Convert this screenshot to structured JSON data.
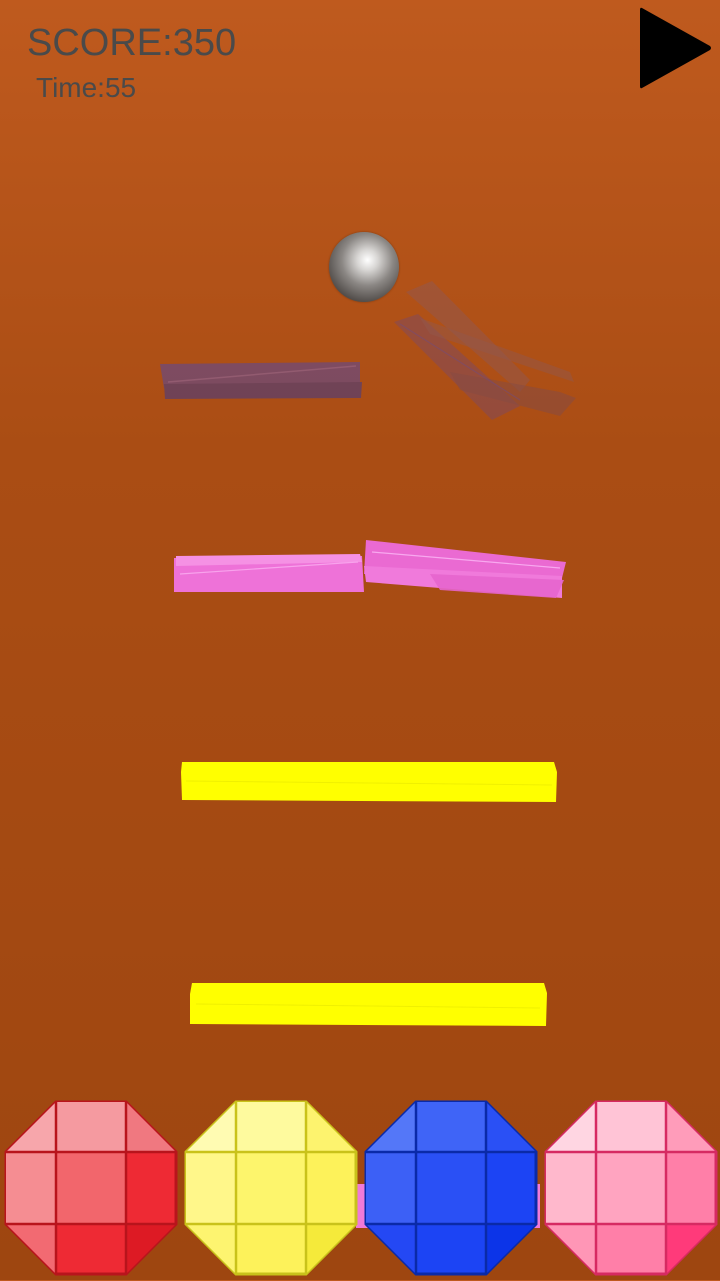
{
  "hud": {
    "score_label": "SCORE:350",
    "time_label": "Time:55"
  },
  "play_button": {
    "icon": "play-icon"
  },
  "ball": {
    "icon": "ball-icon"
  },
  "platforms": [
    {
      "color": "#6e4a78",
      "state": "shattering"
    },
    {
      "color": "#ee72d8",
      "state": "shattering"
    },
    {
      "color": "#ffff00",
      "state": "intact"
    },
    {
      "color": "#ffff00",
      "state": "intact"
    }
  ],
  "color_buttons": [
    {
      "color": "red",
      "hex": "#ee2a34"
    },
    {
      "color": "yellow",
      "hex": "#fdf25a"
    },
    {
      "color": "blue",
      "hex": "#1c44f4"
    },
    {
      "color": "pink",
      "hex": "#ff7fa8"
    }
  ]
}
